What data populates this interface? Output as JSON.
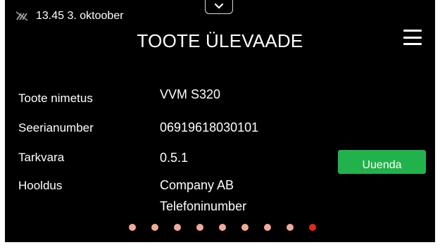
{
  "status": {
    "icon": "no-connection-icon",
    "datetime": "13.45 3. oktoober"
  },
  "header": {
    "pulltab_icon": "chevron-down-icon",
    "title": "TOOTE ÜLEVAADE",
    "menu_icon": "hamburger-menu-icon"
  },
  "info": {
    "product_name_label": "Toote nimetus",
    "product_name_value": "VVM S320",
    "serial_label": "Seerianumber",
    "serial_value": "06919618030101",
    "software_label": "Tarkvara",
    "software_value": "0.5.1",
    "service_label": "Hooldus",
    "service_company": "Company AB",
    "service_phone": "Telefoninumber"
  },
  "actions": {
    "update_label": "Uuenda",
    "update_color": "#22b24c"
  },
  "pagination": {
    "total_pages": 9,
    "current_page": 9,
    "active_color": "#e12a12",
    "inactive_color": "#f3a99a"
  }
}
